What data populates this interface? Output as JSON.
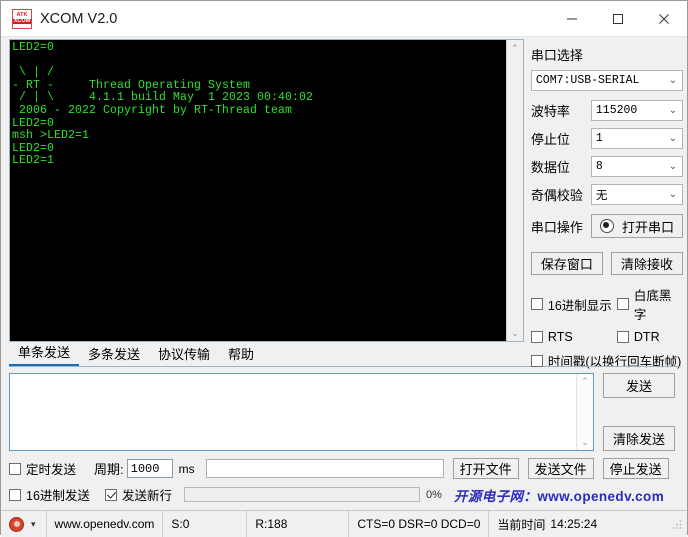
{
  "window": {
    "title": "XCOM V2.0",
    "icon_line1": "ATK",
    "icon_line2": "XCOM",
    "minimize": "—",
    "maximize": "□",
    "close": "×"
  },
  "terminal": {
    "text": "LED2=0\n\n \\ | /\n- RT -     Thread Operating System\n / | \\     4.1.1 build May  1 2023 00:40:02\n 2006 - 2022 Copyright by RT-Thread team\nLED2=0\nmsh >LED2=1\nLED2=0\nLED2=1",
    "fg_color": "#2ee02e",
    "bg_color": "#000000",
    "scroll_up": "⌃",
    "scroll_down": "⌄"
  },
  "settings": {
    "port_section_label": "串口选择",
    "port_value": "COM7:USB-SERIAL",
    "baud_label": "波特率",
    "baud_value": "115200",
    "stopbits_label": "停止位",
    "stopbits_value": "1",
    "databits_label": "数据位",
    "databits_value": "8",
    "parity_label": "奇偶校验",
    "parity_value": "无",
    "operation_label": "串口操作",
    "open_port_label": "打开串口",
    "open_port_state": "on",
    "save_window_label": "保存窗口",
    "clear_receive_label": "清除接收",
    "hex_display_label": "16进制显示",
    "hex_display_checked": false,
    "white_bg_label": "白底黑字",
    "white_bg_checked": false,
    "rts_label": "RTS",
    "rts_checked": false,
    "dtr_label": "DTR",
    "dtr_checked": false,
    "timestamp_label": "时间戳(以换行回车断帧)",
    "timestamp_checked": false,
    "chevron": "⌄"
  },
  "tabs": [
    {
      "label": "单条发送",
      "active": true
    },
    {
      "label": "多条发送",
      "active": false
    },
    {
      "label": "协议传输",
      "active": false
    },
    {
      "label": "帮助",
      "active": false
    }
  ],
  "send": {
    "input_value": "",
    "send_label": "发送",
    "clear_send_label": "清除发送",
    "scroll_up": "⌃",
    "scroll_down": "⌄"
  },
  "options": {
    "timed_send_label": "定时发送",
    "timed_send_checked": false,
    "period_label": "周期:",
    "period_value": "1000",
    "ms_label": "ms",
    "file_path_value": "",
    "open_file_label": "打开文件",
    "send_file_label": "发送文件",
    "stop_send_label": "停止发送",
    "hex_send_label": "16进制发送",
    "hex_send_checked": false,
    "newline_label": "发送新行",
    "newline_checked": true,
    "progress_percent": "0%",
    "promo_cn": "开源电子网：",
    "promo_url": "www.openedv.com",
    "promo_color": "#2b2bbd"
  },
  "statusbar": {
    "site": "www.openedv.com",
    "sent": "S:0",
    "received": "R:188",
    "signals": "CTS=0 DSR=0 DCD=0",
    "time_label": "当前时间",
    "time_value": "14:25:24",
    "caret": "▾"
  }
}
